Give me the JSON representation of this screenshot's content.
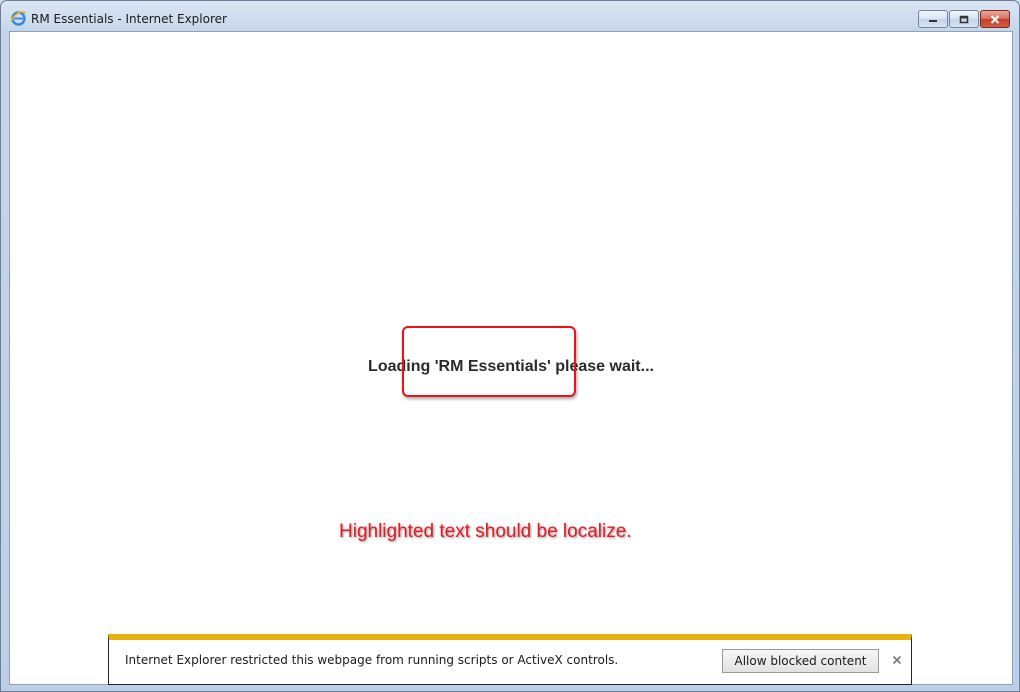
{
  "window": {
    "title": "RM Essentials - Internet Explorer",
    "app_icon": "internet-explorer-icon",
    "caption_buttons": [
      "minimize-icon",
      "restore-icon",
      "close-icon"
    ]
  },
  "content": {
    "loading_message": "Loading 'RM Essentials' please wait...",
    "annotation": "Highlighted text should be localize.",
    "annotation_color": "#e31b23",
    "highlight_color": "#e8141a"
  },
  "info_bar": {
    "message": "Internet Explorer restricted this webpage from running scripts or ActiveX controls.",
    "allow_button_label": "Allow blocked content",
    "close_icon": "close-icon",
    "accent_color": "#e8b30f"
  }
}
